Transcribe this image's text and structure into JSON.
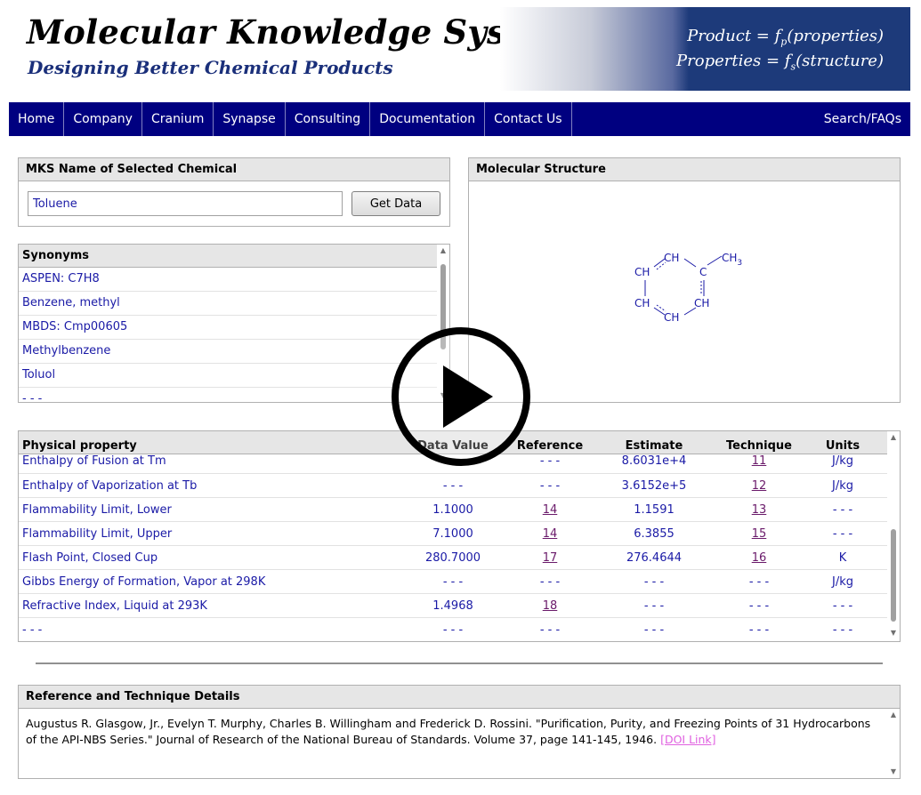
{
  "header": {
    "title": "Molecular Knowledge Systems",
    "tagline": "Designing Better Chemical Products",
    "formula_1_left": "Product = ",
    "formula_1_f": "f",
    "formula_1_sub": "p",
    "formula_1_right": "(properties)",
    "formula_2_left": "Properties = ",
    "formula_2_f": "f",
    "formula_2_sub": "s",
    "formula_2_right": "(structure)"
  },
  "nav": {
    "items": [
      "Home",
      "Company",
      "Cranium",
      "Synapse",
      "Consulting",
      "Documentation",
      "Contact Us"
    ],
    "search": "Search/FAQs"
  },
  "name_panel": {
    "heading": "MKS Name of Selected Chemical",
    "input_value": "Toluene",
    "button_label": "Get Data"
  },
  "synonyms": {
    "heading": "Synonyms",
    "items": [
      "ASPEN: C7H8",
      "Benzene, methyl",
      "MBDS: Cmp00605",
      "Methylbenzene",
      "Toluol",
      "- - -"
    ]
  },
  "structure": {
    "heading": "Molecular Structure",
    "atom_ch": "CH",
    "atom_c": "C",
    "atom_ch3": "CH",
    "atom_ch3_sub": "3"
  },
  "properties": {
    "headers": {
      "property": "Physical property",
      "value": "Data Value",
      "reference": "Reference",
      "estimate": "Estimate",
      "technique": "Technique",
      "units": "Units"
    },
    "rows": [
      {
        "property": "Enthalpy of Fusion at Tm",
        "value": "",
        "reference": "- - -",
        "estimate": "8.6031e+4",
        "technique": "11",
        "units": "J/kg"
      },
      {
        "property": "Enthalpy of Vaporization at Tb",
        "value": "- - -",
        "reference": "- - -",
        "estimate": "3.6152e+5",
        "technique": "12",
        "units": "J/kg"
      },
      {
        "property": "Flammability Limit, Lower",
        "value": "1.1000",
        "reference": "14",
        "estimate": "1.1591",
        "technique": "13",
        "units": "- - -"
      },
      {
        "property": "Flammability Limit, Upper",
        "value": "7.1000",
        "reference": "14",
        "estimate": "6.3855",
        "technique": "15",
        "units": "- - -"
      },
      {
        "property": "Flash Point, Closed Cup",
        "value": "280.7000",
        "reference": "17",
        "estimate": "276.4644",
        "technique": "16",
        "units": "K"
      },
      {
        "property": "Gibbs Energy of Formation, Vapor at 298K",
        "value": "- - -",
        "reference": "- - -",
        "estimate": "- - -",
        "technique": "- - -",
        "units": "J/kg"
      },
      {
        "property": "Refractive Index, Liquid at 293K",
        "value": "1.4968",
        "reference": "18",
        "estimate": "- - -",
        "technique": "- - -",
        "units": "- - -"
      },
      {
        "property": "- - -",
        "value": "- - -",
        "reference": "- - -",
        "estimate": "- - -",
        "technique": "- - -",
        "units": "- - -"
      }
    ]
  },
  "reference_details": {
    "heading": "Reference and Technique Details",
    "text": "Augustus R. Glasgow, Jr., Evelyn T. Murphy, Charles B. Willingham and Frederick D. Rossini. \"Purification, Purity, and Freezing Points of 31 Hydrocarbons of the API-NBS Series.\" Journal of Research of the National Bureau of Standards. Volume 37, page 141-145, 1946. ",
    "doi_label": "[DOI Link]"
  },
  "colors": {
    "nav_bg": "#000080",
    "link": "#1a1aa6",
    "visited_link": "#6a1a6a",
    "doi_link": "#e060e0"
  }
}
